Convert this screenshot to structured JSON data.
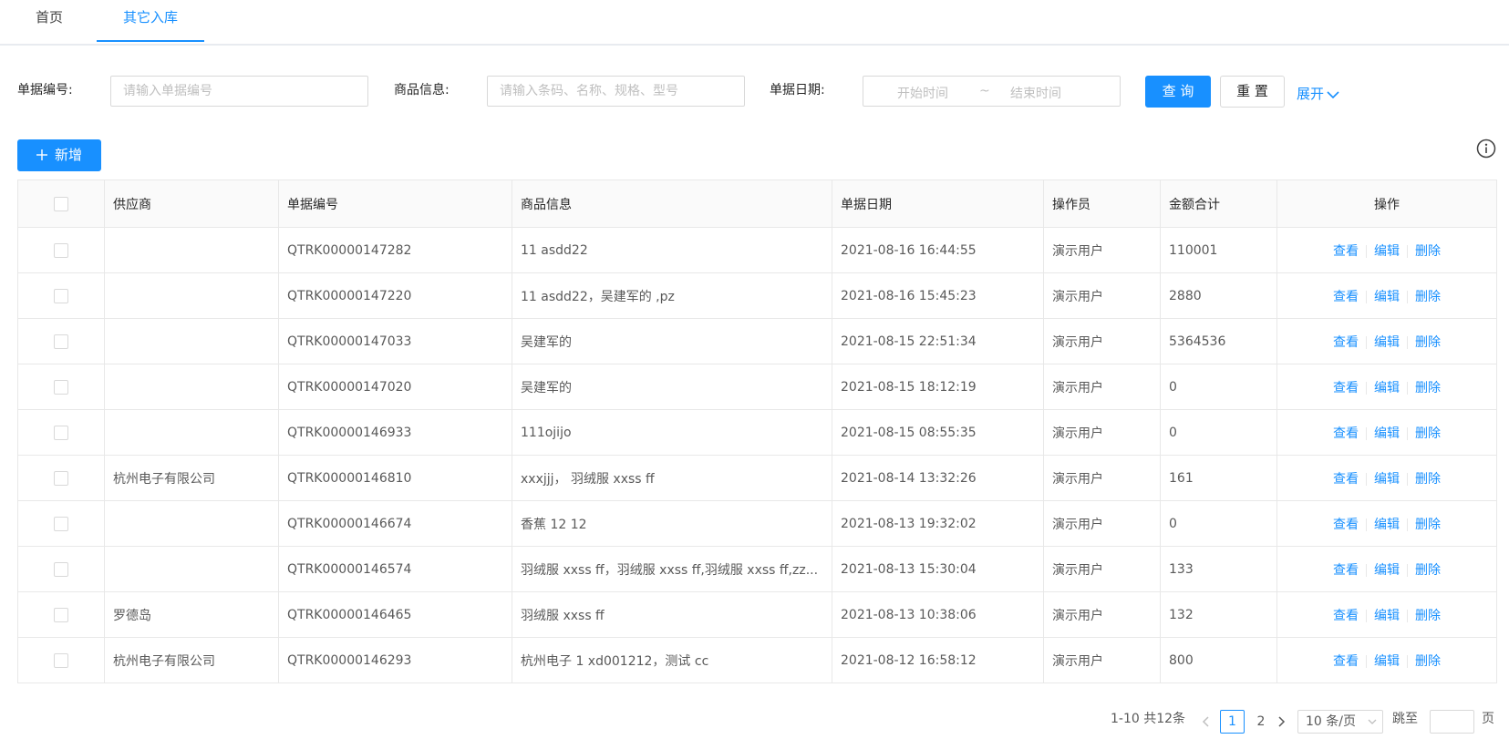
{
  "tabs": [
    {
      "label": "首页",
      "active": false
    },
    {
      "label": "其它入库",
      "active": true
    }
  ],
  "filters": {
    "bill_no": {
      "label": "单据编号:",
      "placeholder": "请输入单据编号",
      "value": ""
    },
    "product": {
      "label": "商品信息:",
      "placeholder": "请输入条码、名称、规格、型号",
      "value": ""
    },
    "date": {
      "label": "单据日期:",
      "start_placeholder": "开始时间",
      "separator": "~",
      "end_placeholder": "结束时间"
    },
    "search_label": "查 询",
    "reset_label": "重 置",
    "expand_label": "展开"
  },
  "toolbar": {
    "add_icon": "plus-icon",
    "add_label": "新增",
    "info_icon": "info-circle-icon"
  },
  "table": {
    "columns": [
      "供应商",
      "单据编号",
      "商品信息",
      "单据日期",
      "操作员",
      "金额合计",
      "操作"
    ],
    "actions": {
      "view": "查看",
      "edit": "编辑",
      "delete": "删除"
    },
    "rows": [
      {
        "supplier": "",
        "bill_no": "QTRK00000147282",
        "product": "11 asdd22",
        "date": "2021-08-16 16:44:55",
        "operator": "演示用户",
        "amount": "110001"
      },
      {
        "supplier": "",
        "bill_no": "QTRK00000147220",
        "product": "11 asdd22，吴建军的 ,pz",
        "date": "2021-08-16 15:45:23",
        "operator": "演示用户",
        "amount": "2880"
      },
      {
        "supplier": "",
        "bill_no": "QTRK00000147033",
        "product": "吴建军的",
        "date": "2021-08-15 22:51:34",
        "operator": "演示用户",
        "amount": "5364536"
      },
      {
        "supplier": "",
        "bill_no": "QTRK00000147020",
        "product": "吴建军的",
        "date": "2021-08-15 18:12:19",
        "operator": "演示用户",
        "amount": "0"
      },
      {
        "supplier": "",
        "bill_no": "QTRK00000146933",
        "product": "111ojijo",
        "date": "2021-08-15 08:55:35",
        "operator": "演示用户",
        "amount": "0"
      },
      {
        "supplier": "杭州电子有限公司",
        "bill_no": "QTRK00000146810",
        "product": "xxxjjj， 羽绒服 xxss ff",
        "date": "2021-08-14 13:32:26",
        "operator": "演示用户",
        "amount": "161"
      },
      {
        "supplier": "",
        "bill_no": "QTRK00000146674",
        "product": "香蕉 12 12",
        "date": "2021-08-13 19:32:02",
        "operator": "演示用户",
        "amount": "0"
      },
      {
        "supplier": "",
        "bill_no": "QTRK00000146574",
        "product": "羽绒服 xxss ff，羽绒服 xxss ff,羽绒服 xxss ff,zz...",
        "date": "2021-08-13 15:30:04",
        "operator": "演示用户",
        "amount": "133"
      },
      {
        "supplier": "罗德岛",
        "bill_no": "QTRK00000146465",
        "product": "羽绒服 xxss ff",
        "date": "2021-08-13 10:38:06",
        "operator": "演示用户",
        "amount": "132"
      },
      {
        "supplier": "杭州电子有限公司",
        "bill_no": "QTRK00000146293",
        "product": "杭州电子 1 xd001212，测试 cc",
        "date": "2021-08-12 16:58:12",
        "operator": "演示用户",
        "amount": "800"
      }
    ]
  },
  "pagination": {
    "summary": "1-10 共12条",
    "pages": [
      "1",
      "2"
    ],
    "current_page": "1",
    "page_size": "10 条/页",
    "jump_label": "跳至",
    "page_suffix": "页"
  },
  "colors": {
    "primary": "#1890ff",
    "border": "#d9d9d9",
    "header_bg": "#fafafa"
  }
}
